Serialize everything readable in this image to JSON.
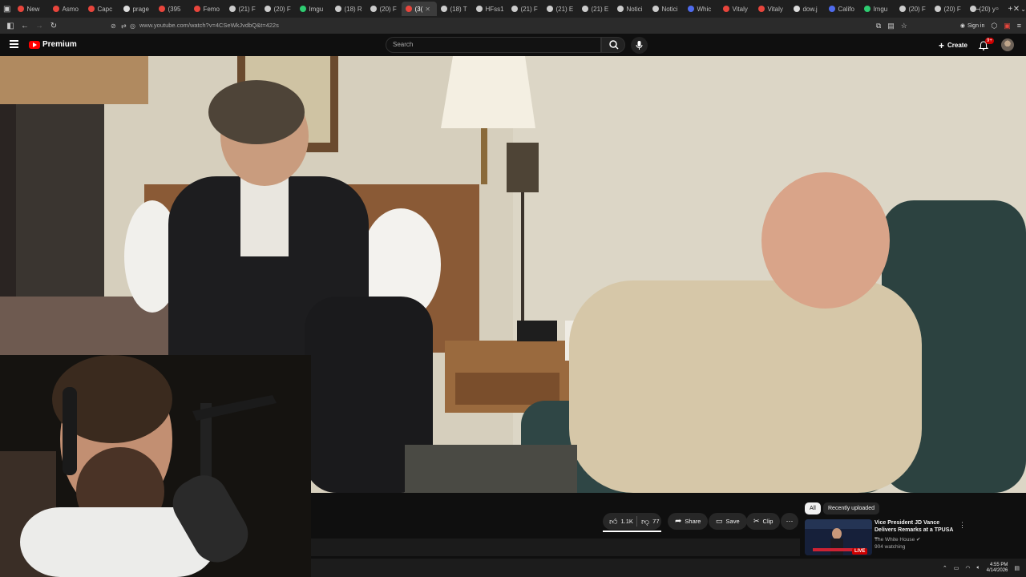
{
  "browser": {
    "tabs": [
      {
        "label": "New",
        "color": "#e8453c"
      },
      {
        "label": "Asmo",
        "color": "#e8453c"
      },
      {
        "label": "Capc",
        "color": "#e8453c"
      },
      {
        "label": "prage",
        "color": "#dddddd"
      },
      {
        "label": "(395",
        "color": "#e8453c"
      },
      {
        "label": "Femo",
        "color": "#e8453c"
      },
      {
        "label": "(21) F",
        "color": "#cccccc"
      },
      {
        "label": "(20) F",
        "color": "#cccccc"
      },
      {
        "label": "Imgu",
        "color": "#2ecc71"
      },
      {
        "label": "(18) R",
        "color": "#cccccc"
      },
      {
        "label": "(20) F",
        "color": "#cccccc"
      },
      {
        "label": "(3(",
        "color": "#e8453c",
        "active": true
      },
      {
        "label": "(18) T",
        "color": "#cccccc"
      },
      {
        "label": "HFss1",
        "color": "#cccccc"
      },
      {
        "label": "(21) F",
        "color": "#cccccc"
      },
      {
        "label": "(21) E",
        "color": "#cccccc"
      },
      {
        "label": "(21) E",
        "color": "#cccccc"
      },
      {
        "label": "Notici",
        "color": "#cccccc"
      },
      {
        "label": "Notici",
        "color": "#cccccc"
      },
      {
        "label": "Whic",
        "color": "#4f6bed"
      },
      {
        "label": "Vitaly",
        "color": "#e8453c"
      },
      {
        "label": "Vitaly",
        "color": "#e8453c"
      },
      {
        "label": "dow.j",
        "color": "#dddddd"
      },
      {
        "label": "Califo",
        "color": "#4f6bed"
      },
      {
        "label": "Imgu",
        "color": "#2ecc71"
      },
      {
        "label": "(20) F",
        "color": "#cccccc"
      },
      {
        "label": "(20) F",
        "color": "#cccccc"
      },
      {
        "label": "(20) y",
        "color": "#cccccc"
      }
    ],
    "url": "www.youtube.com/watch?v=4CSeWkJvdbQ&t=422s",
    "sign_in": "Sign in"
  },
  "youtube": {
    "logo_text": "Premium",
    "search_placeholder": "Search",
    "create_label": "Create",
    "notif_badge": "9+",
    "accent": "#ff0000"
  },
  "actions": {
    "likes": "1.1K",
    "dislikes": "77",
    "share": "Share",
    "save": "Save",
    "clip": "Clip"
  },
  "sidebar": {
    "chips": [
      "All",
      "Recently uploaded"
    ],
    "rec": {
      "title": "Vice President JD Vance Delivers Remarks at a TPUSA ...",
      "channel": "The White House",
      "watching": "904 watching",
      "live": "LIVE"
    }
  },
  "taskbar": {
    "time": "4:55 PM",
    "date": "4/14/2026"
  }
}
